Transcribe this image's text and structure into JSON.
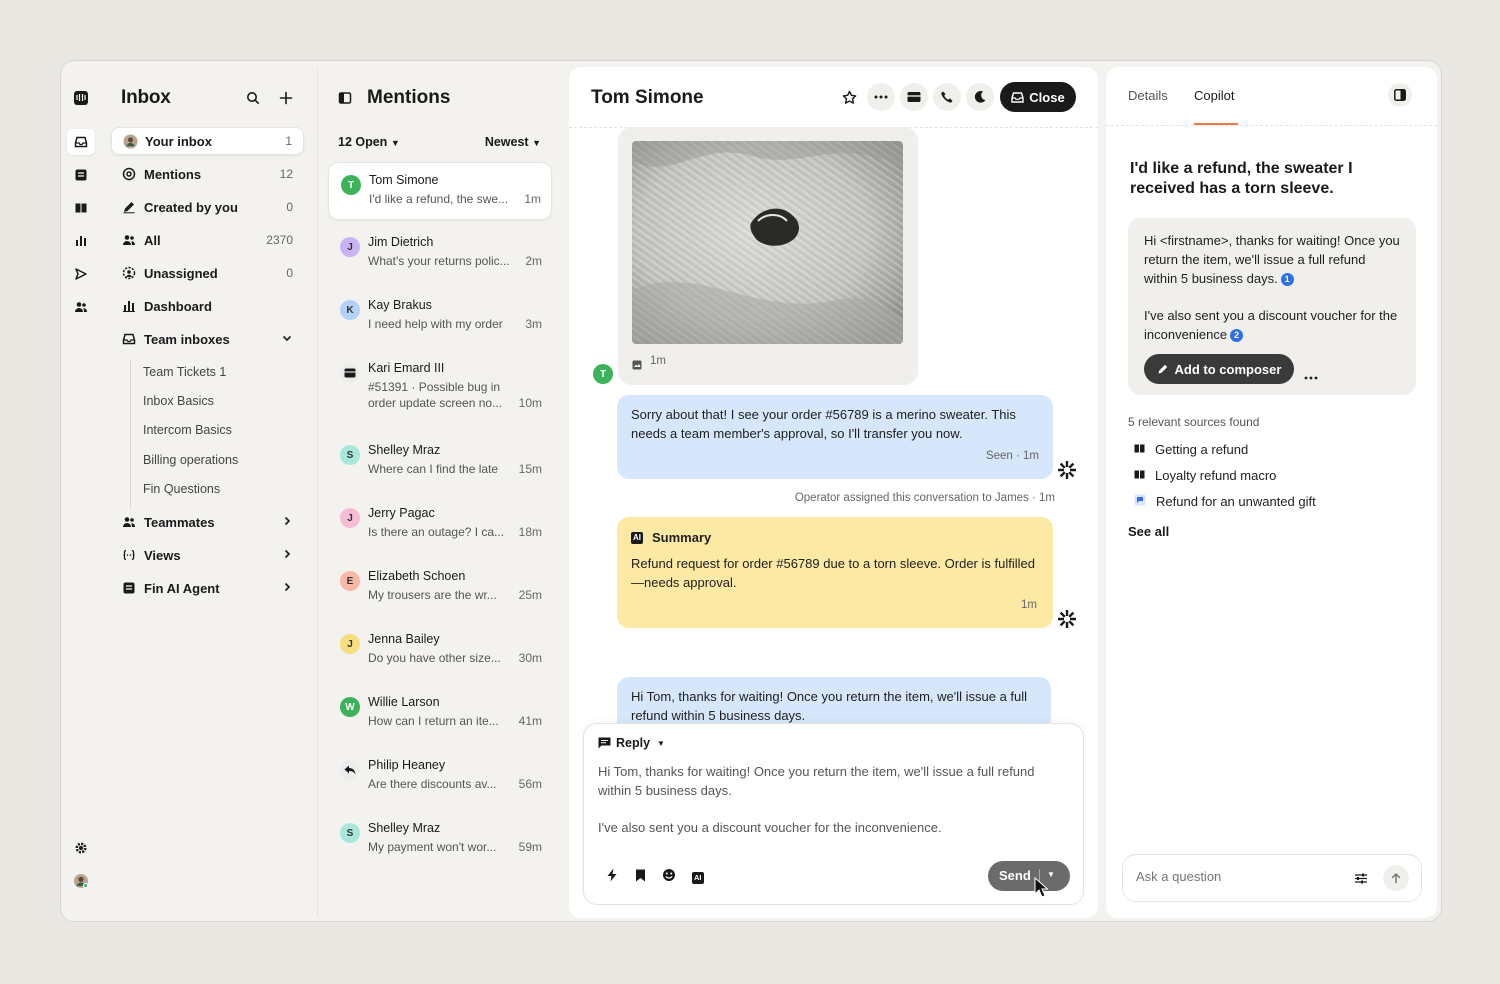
{
  "sidebar": {
    "title": "Inbox",
    "items": [
      {
        "label": "Your inbox",
        "count": "1"
      },
      {
        "label": "Mentions",
        "count": "12"
      },
      {
        "label": "Created by you",
        "count": "0"
      },
      {
        "label": "All",
        "count": "2370"
      },
      {
        "label": "Unassigned",
        "count": "0"
      },
      {
        "label": "Dashboard",
        "count": ""
      },
      {
        "label": "Team inboxes",
        "count": ""
      }
    ],
    "team_inboxes": [
      "Team Tickets 1",
      "Inbox Basics",
      "Intercom Basics",
      "Billing operations",
      "Fin Questions"
    ],
    "sections": [
      "Teammates",
      "Views",
      "Fin AI Agent"
    ]
  },
  "list": {
    "title": "Mentions",
    "filter_open": "12 Open",
    "filter_sort": "Newest",
    "conversations": [
      {
        "initial": "T",
        "name": "Tom Simone",
        "preview": "I'd like a refund, the swe...",
        "time": "1m",
        "color": "#3cb35a"
      },
      {
        "initial": "J",
        "name": "Jim Dietrich",
        "preview": "What's your returns polic...",
        "time": "2m",
        "color": "#b59af0"
      },
      {
        "initial": "K",
        "name": "Kay Brakus",
        "preview": "I need help with my order",
        "time": "3m",
        "color": "#9fc3f7"
      },
      {
        "initial": "",
        "name": "Kari Emard III",
        "preview": "#51391 · Possible bug in",
        "preview2": "order update screen no...",
        "time": "10m",
        "color": "#ececec"
      },
      {
        "initial": "S",
        "name": "Shelley Mraz",
        "preview": "Where can I find the late",
        "time": "15m",
        "color": "#8ee0d2"
      },
      {
        "initial": "J",
        "name": "Jerry Pagac",
        "preview": "Is there an outage? I ca...",
        "time": "18m",
        "color": "#f4a6c8"
      },
      {
        "initial": "E",
        "name": "Elizabeth Schoen",
        "preview": "My trousers are the wr...",
        "time": "25m",
        "color": "#f7a48b"
      },
      {
        "initial": "J",
        "name": "Jenna Bailey",
        "preview": "Do you have other size...",
        "time": "30m",
        "color": "#f5d76e"
      },
      {
        "initial": "W",
        "name": "Willie Larson",
        "preview": "How can I return an ite...",
        "time": "41m",
        "color": "#3cb35a"
      },
      {
        "initial": "",
        "name": "Philip Heaney",
        "preview": "Are there discounts av...",
        "time": "56m",
        "color": "#ececec"
      },
      {
        "initial": "S",
        "name": "Shelley Mraz",
        "preview": "My payment won't wor...",
        "time": "59m",
        "color": "#8ee0d2"
      }
    ]
  },
  "conversation": {
    "title": "Tom Simone",
    "close_label": "Close",
    "customer_initial": "T",
    "image_time": "1m",
    "msg1": "Sorry about that! I see your order #56789 is a merino sweater. This needs a team member's approval, so I'll transfer you now.",
    "msg1_meta": "Seen · 1m",
    "event": "Operator assigned this conversation to James · 1m",
    "summary_title": "Summary",
    "summary_badge": "AI",
    "summary_text": "Refund request for order #56789 due to a torn sleeve. Order is fulfilled—needs approval.",
    "summary_time": "1m",
    "msg2": "Hi Tom, thanks for waiting! Once you return the item, we'll issue a full refund within 5 business days."
  },
  "composer": {
    "mode": "Reply",
    "text1": "Hi Tom, thanks for waiting! Once you return the item, we'll issue a full refund within 5 business days.",
    "text2": "I've also sent you a discount voucher for the inconvenience.",
    "ai_badge": "AI",
    "send_label": "Send"
  },
  "copilot": {
    "tab_details": "Details",
    "tab_copilot": "Copilot",
    "question": "I'd like a refund, the sweater I received has a torn sleeve.",
    "answer1": "Hi <firstname>, thanks for waiting! Once you return the item, we'll issue a full refund within 5 business days.",
    "cite1": "1",
    "answer2": "I've also sent you a discount voucher for the inconvenience",
    "cite2": "2",
    "add_label": "Add to composer",
    "sources_title": "5 relevant sources found",
    "sources": [
      "Getting a refund",
      "Loyalty refund macro",
      "Refund for an unwanted gift"
    ],
    "see_all": "See all",
    "ask_placeholder": "Ask a question"
  },
  "colors": {
    "accent": "#e87a49",
    "customer_bubble": "#d6e6fb",
    "summary_bubble": "#fbe9a4",
    "citation": "#2f6fe8"
  }
}
